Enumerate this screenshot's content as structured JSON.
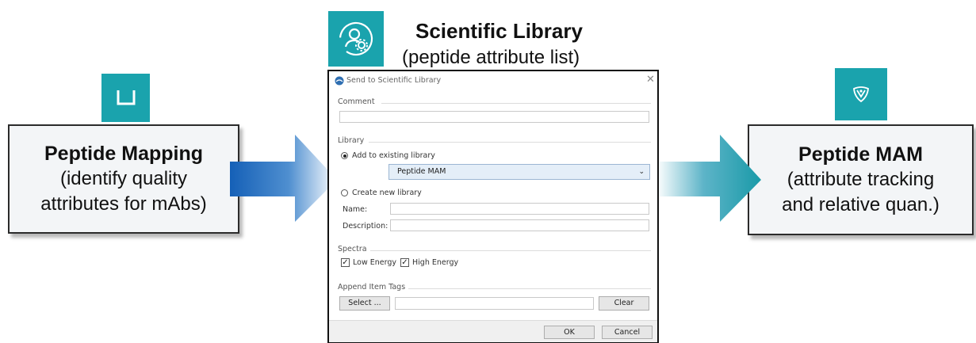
{
  "library_header": {
    "title": "Scientific Library",
    "subtitle": "(peptide attribute list)",
    "icon": "library-user-gear-icon"
  },
  "left_box": {
    "title": "Peptide Mapping",
    "lines": [
      "(identify quality",
      "attributes for mAbs)"
    ],
    "icon": "unifi-u-icon"
  },
  "right_box": {
    "title": "Peptide MAM",
    "lines": [
      "(attribute tracking",
      "and relative quan.)"
    ],
    "icon": "mam-shield-icon"
  },
  "colors": {
    "teal_icon": "#1aa3ad",
    "arrow_blue": "#1560b7",
    "arrow_teal": "#1a9aa8"
  },
  "dialog": {
    "title": "Send to Scientific Library",
    "comment_label": "Comment",
    "comment_value": "",
    "library_label": "Library",
    "add_existing_label": "Add to existing library",
    "add_existing_selected": true,
    "existing_library_value": "Peptide MAM",
    "create_new_label": "Create new library",
    "create_new_selected": false,
    "name_label": "Name:",
    "name_value": "",
    "description_label": "Description:",
    "description_value": "",
    "spectra_label": "Spectra",
    "low_energy_label": "Low Energy",
    "low_energy_checked": true,
    "high_energy_label": "High Energy",
    "high_energy_checked": true,
    "append_tags_label": "Append Item Tags",
    "select_button": "Select ...",
    "tags_value": "",
    "clear_button": "Clear",
    "ok_button": "OK",
    "cancel_button": "Cancel"
  }
}
